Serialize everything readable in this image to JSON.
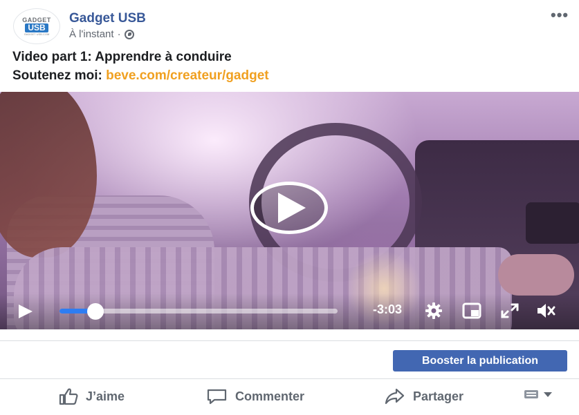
{
  "post": {
    "page_name": "Gadget USB",
    "timestamp": "À l'instant",
    "separator": "·",
    "avatar": {
      "line1": "GADGET",
      "line2": "USB",
      "line3": "GADGET USB.COM"
    },
    "more_label": "•••",
    "text_line1": "Video part 1: Apprendre à conduire",
    "text_line2_prefix": "Soutenez moi: ",
    "text_line2_link": "beve.com/createur/gadget"
  },
  "video": {
    "time_remaining": "-3:03",
    "progress": 0.13,
    "controls": [
      "play-icon",
      "settings-icon",
      "pip-icon",
      "fullscreen-icon",
      "mute-icon"
    ]
  },
  "boost": {
    "label": "Booster la publication"
  },
  "actions": {
    "like": "J’aime",
    "comment": "Commenter",
    "share": "Partager"
  },
  "colors": {
    "brand": "#385898",
    "boost": "#4267b2",
    "link": "#f0a020",
    "progress": "#2e7df2"
  }
}
